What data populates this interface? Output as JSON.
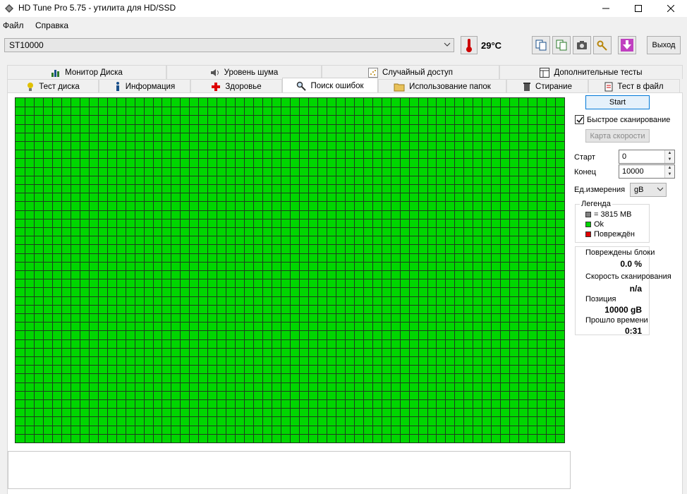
{
  "window": {
    "title": "HD Tune Pro 5.75 - утилита для HD/SSD"
  },
  "menu": {
    "file": "Файл",
    "help": "Справка"
  },
  "toolbar": {
    "drive": "ST10000",
    "temperature": "29°C",
    "exit_label": "Выход"
  },
  "tabs": {
    "top": [
      "Монитор Диска",
      "Уровень шума",
      "Случайный доступ",
      "Дополнительные  тесты"
    ],
    "bottom": [
      "Тест диска",
      "Информация",
      "Здоровье",
      "Поиск ошибок",
      "Использование папок",
      "Стирание",
      "Тест в файл"
    ],
    "active": "Поиск ошибок"
  },
  "scan": {
    "start_label": "Start",
    "quick_scan_label": "Быстрое сканирование",
    "quick_scan_checked": true,
    "speed_map_label": "Карта скорости",
    "start_field_label": "Старт",
    "start_value": "0",
    "end_field_label": "Конец",
    "end_value": "10000",
    "units_label": "Ед.измерения",
    "units_value": "gB"
  },
  "legend": {
    "title": "Легенда",
    "items": [
      {
        "label": "= 3815 MB",
        "color": "#808080"
      },
      {
        "label": "Ok",
        "color": "#00d600"
      },
      {
        "label": "Повреждён",
        "color": "#e00000"
      }
    ]
  },
  "stats": {
    "damaged_label": "Повреждены блоки",
    "damaged_value": "0.0 %",
    "speed_label": "Скорость сканирования",
    "speed_value": "n/a",
    "position_label": "Позиция",
    "position_value": "10000 gB",
    "elapsed_label": "Прошло времени",
    "elapsed_value": "0:31"
  },
  "colors": {
    "ok_block": "#00d600",
    "grid_line": "#1d3d1d",
    "accent": "#0078d7"
  },
  "block_map": {
    "columns": 60,
    "rows": 40,
    "status": "ok"
  }
}
